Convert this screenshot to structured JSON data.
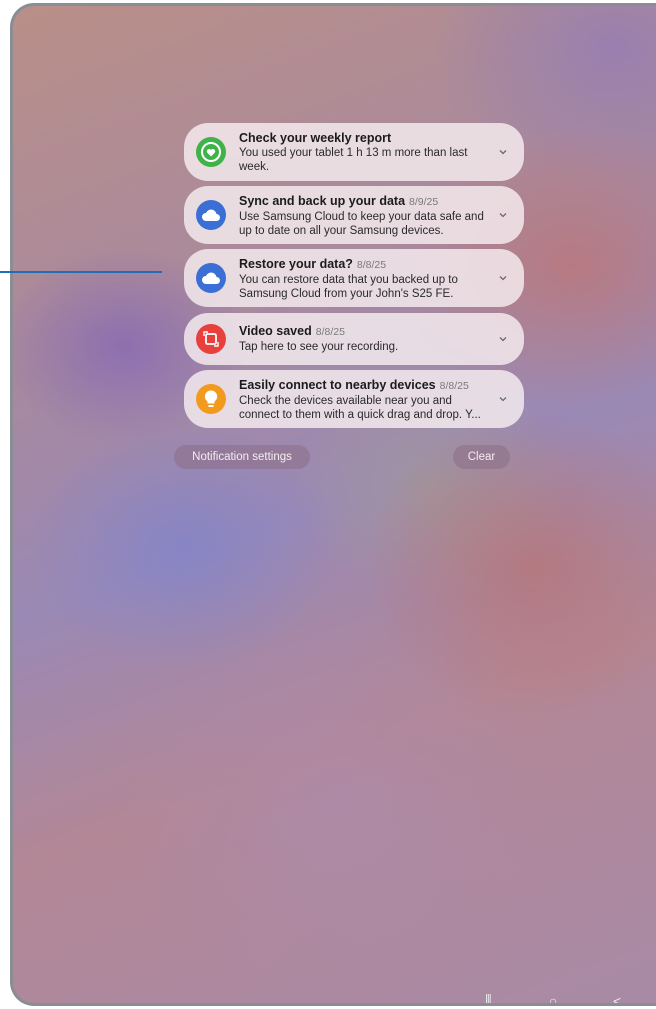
{
  "notifications": [
    {
      "title": "Check your weekly report",
      "date": "",
      "body": "You used your tablet 1 h 13 m more than last week.",
      "icon": "digital-wellbeing-icon",
      "icon_color": "#3fb24a"
    },
    {
      "title": "Sync and back up your data",
      "date": "8/9/25",
      "body": "Use Samsung Cloud to keep your data safe and up to date on all your Samsung devices.",
      "icon": "samsung-cloud-icon",
      "icon_color": "#3b6fd6"
    },
    {
      "title": "Restore your data?",
      "date": "8/8/25",
      "body": "You can restore data that you backed up to Samsung Cloud from your John's S25 FE.",
      "icon": "samsung-cloud-icon",
      "icon_color": "#3b6fd6"
    },
    {
      "title": "Video saved",
      "date": "8/8/25",
      "body": "Tap here to see your recording.",
      "icon": "screen-recorder-icon",
      "icon_color": "#e8413d"
    },
    {
      "title": "Easily connect to nearby devices",
      "date": "8/8/25",
      "body": "Check the devices available near you and connect to them with a quick drag and drop. Y...",
      "icon": "lightbulb-icon",
      "icon_color": "#f29a1e"
    }
  ],
  "actions": {
    "settings_label": "Notification settings",
    "clear_label": "Clear"
  },
  "navbar": {
    "recents": "|||",
    "home": "○",
    "back": "<"
  },
  "colors": {
    "callout": "#1f6fb5",
    "card_bg": "#f6eef0"
  }
}
